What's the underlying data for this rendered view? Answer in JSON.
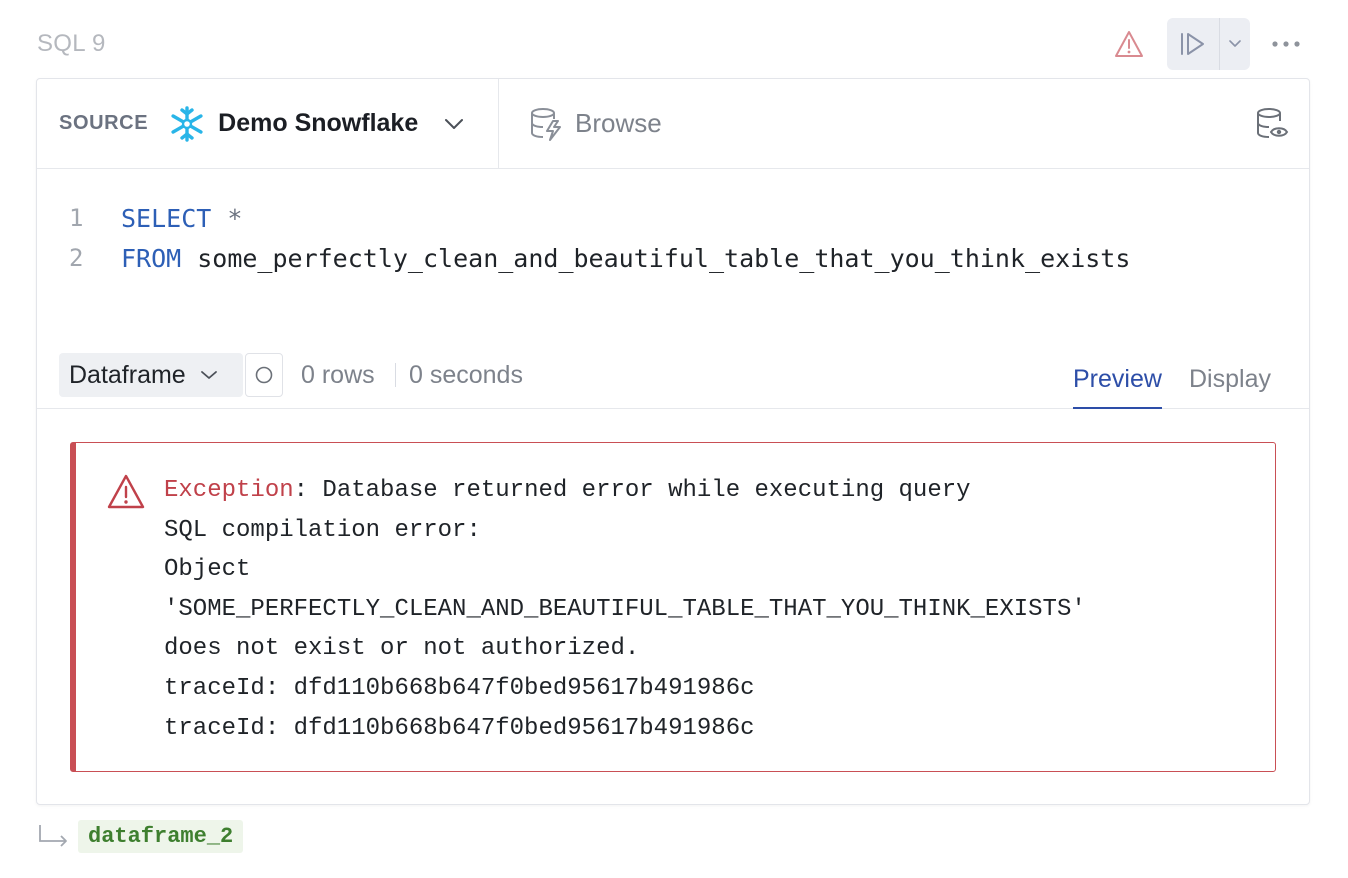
{
  "cell": {
    "title": "SQL 9"
  },
  "toolbar": {
    "source_label": "SOURCE",
    "source_name": "Demo Snowflake",
    "browse_label": "Browse"
  },
  "editor": {
    "lines": [
      {
        "num": "1",
        "keyword": "SELECT",
        "rest": "*"
      },
      {
        "num": "2",
        "keyword": "FROM",
        "rest": "some_perfectly_clean_and_beautiful_table_that_you_think_exists"
      }
    ]
  },
  "result": {
    "output_type": "Dataframe",
    "rows": "0 rows",
    "seconds": "0 seconds",
    "tabs": {
      "preview": "Preview",
      "display": "Display"
    }
  },
  "error": {
    "label": "Exception",
    "first_line_rest": ": Database returned error while executing query",
    "lines": [
      "SQL compilation error:",
      "Object",
      "'SOME_PERFECTLY_CLEAN_AND_BEAUTIFUL_TABLE_THAT_YOU_THINK_EXISTS'",
      "does not exist or not authorized.",
      "traceId: dfd110b668b647f0bed95617b491986c",
      "traceId: dfd110b668b647f0bed95617b491986c"
    ]
  },
  "output": {
    "variable": "dataframe_2"
  },
  "colors": {
    "error": "#c94f55",
    "keyword": "#2d5fb6",
    "snowflake": "#29b5e8",
    "tab_active": "#2d4ea8",
    "output_var": "#3e7f2f"
  },
  "icons": [
    "warning-icon",
    "run-icon",
    "chevron-down-icon",
    "more-icon",
    "snowflake-icon",
    "browse-icon",
    "database-preview-icon",
    "status-circle-icon",
    "output-arrow-icon"
  ]
}
